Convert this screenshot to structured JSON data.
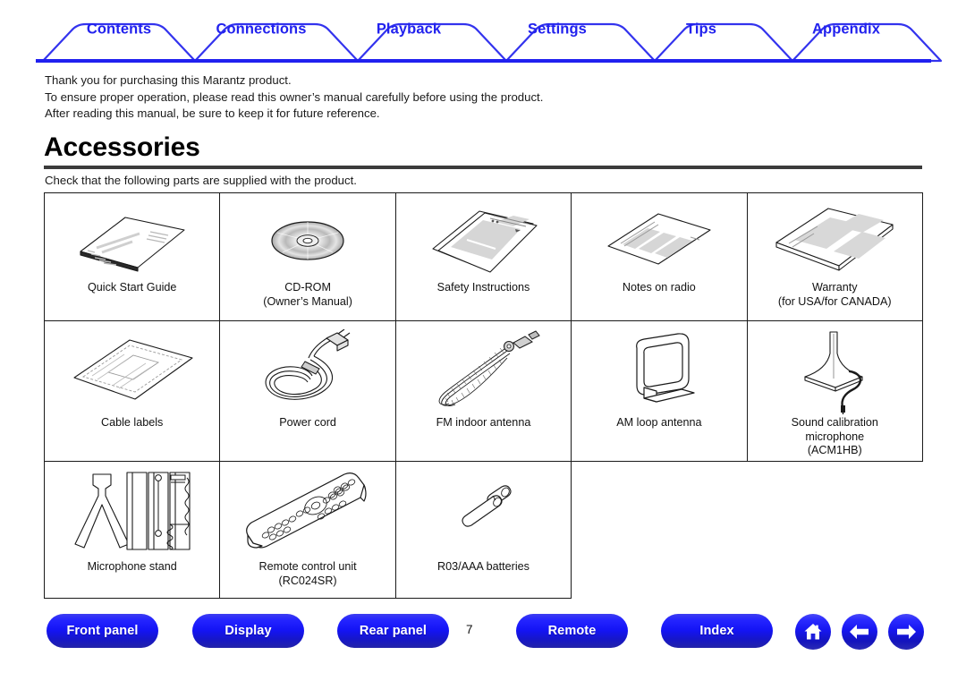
{
  "tabs": [
    {
      "label": "Contents"
    },
    {
      "label": "Connections"
    },
    {
      "label": "Playback"
    },
    {
      "label": "Settings"
    },
    {
      "label": "Tips"
    },
    {
      "label": "Appendix"
    }
  ],
  "intro": {
    "line1": "Thank you for purchasing this Marantz product.",
    "line2": "To ensure proper operation, please read this owner’s manual carefully before using the product.",
    "line3": "After reading this manual, be sure to keep it for future reference."
  },
  "heading": "Accessories",
  "subtext": "Check that the following parts are supplied with the product.",
  "table": {
    "rows": [
      [
        {
          "icon": "booklet-icon",
          "label": "Quick Start Guide"
        },
        {
          "icon": "cd-disc-icon",
          "label": "CD-ROM\n(Owner’s Manual)"
        },
        {
          "icon": "document-stack-icon",
          "label": "Safety Instructions"
        },
        {
          "icon": "leaflet-icon",
          "label": "Notes on radio"
        },
        {
          "icon": "warranty-booklet-icon",
          "label": "Warranty\n(for USA/for CANADA)"
        }
      ],
      [
        {
          "icon": "label-sheet-icon",
          "label": "Cable labels"
        },
        {
          "icon": "power-cord-icon",
          "label": "Power cord"
        },
        {
          "icon": "fm-antenna-icon",
          "label": "FM indoor antenna"
        },
        {
          "icon": "am-loop-antenna-icon",
          "label": "AM loop antenna"
        },
        {
          "icon": "calibration-microphone-icon",
          "label": "Sound calibration\nmicrophone\n(ACM1HB)"
        }
      ],
      [
        {
          "icon": "microphone-stand-icon",
          "label": "Microphone stand"
        },
        {
          "icon": "remote-control-icon",
          "label": "Remote control unit\n(RC024SR)"
        },
        {
          "icon": "aaa-batteries-icon",
          "label": "R03/AAA batteries"
        }
      ]
    ]
  },
  "footer": {
    "buttons": [
      {
        "label": "Front panel"
      },
      {
        "label": "Display"
      },
      {
        "label": "Rear panel"
      },
      {
        "label": "Remote"
      },
      {
        "label": "Index"
      }
    ],
    "page_number": "7",
    "nav_icons": [
      {
        "name": "home-icon"
      },
      {
        "name": "arrow-left-icon"
      },
      {
        "name": "arrow-right-icon"
      }
    ]
  },
  "colors": {
    "tab_blue": "#2222ee",
    "rule_gray": "#3b3b3b",
    "button_blue": "#1414f5"
  }
}
